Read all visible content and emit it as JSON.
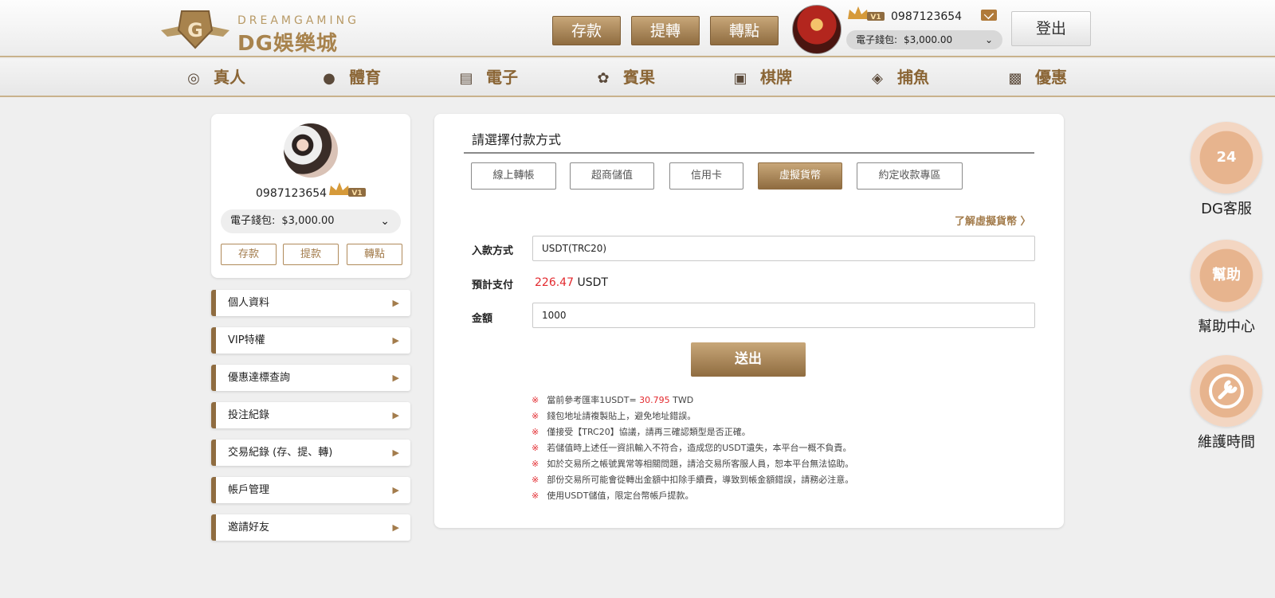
{
  "header": {
    "logo_sub": "DREAMGAMING",
    "logo_main": "DG娛樂城",
    "buttons": [
      "存款",
      "提轉",
      "轉點"
    ],
    "vip_badge": "V1",
    "username": "0987123654",
    "wallet_label": "電子錢包:",
    "wallet_amount": "$3,000.00",
    "logout": "登出"
  },
  "nav": {
    "items": [
      {
        "label": "真人",
        "icon": "live-icon"
      },
      {
        "label": "體育",
        "icon": "ball-icon"
      },
      {
        "label": "電子",
        "icon": "slot-icon"
      },
      {
        "label": "賓果",
        "icon": "bingo-icon"
      },
      {
        "label": "棋牌",
        "icon": "cards-icon"
      },
      {
        "label": "捕魚",
        "icon": "fish-icon"
      },
      {
        "label": "優惠",
        "icon": "gift-icon"
      }
    ]
  },
  "profile": {
    "username": "0987123654",
    "vip_badge": "V1",
    "wallet_label": "電子錢包:",
    "wallet_amount": "$3,000.00",
    "buttons": [
      "存款",
      "提款",
      "轉點"
    ]
  },
  "menu": {
    "items": [
      "個人資料",
      "VIP特權",
      "優惠達標查詢",
      "投注紀錄",
      "交易紀錄 (存、提、轉)",
      "帳戶管理",
      "邀請好友"
    ]
  },
  "payment": {
    "title": "請選擇付款方式",
    "tabs": [
      "線上轉帳",
      "超商儲值",
      "信用卡",
      "虛擬貨幣",
      "約定收款專區"
    ],
    "active_tab": "虛擬貨幣",
    "learn_more": "了解虛擬貨幣 〉",
    "method_label": "入款方式",
    "method_value": "USDT(TRC20)",
    "estimate_label": "預計支付",
    "estimate_value": "226.47",
    "estimate_unit": "USDT",
    "amount_label": "金額",
    "amount_value": "1000",
    "submit": "送出",
    "note_mark": "※",
    "note_rate_prefix": "當前參考匯率1USDT=",
    "note_rate_value": "30.795",
    "note_rate_unit": "TWD",
    "notes": [
      "錢包地址請複製貼上，避免地址錯誤。",
      "僅接受【TRC20】協議，請再三確認類型是否正確。",
      "若儲值時上述任一資訊輸入不符合，造成您的USDT遺失，本平台一概不負責。",
      "如於交易所之帳號異常等相關問題，請洽交易所客服人員，恕本平台無法協助。",
      "部份交易所可能會從轉出金額中扣除手續費，導致到帳金額錯誤，請務必注意。",
      "使用USDT儲值，限定台幣帳戶提款。"
    ]
  },
  "floating": {
    "items": [
      {
        "label": "DG客服",
        "icon_text": "24"
      },
      {
        "label": "幫助中心",
        "icon_text": "幫助"
      },
      {
        "label": "維護時間",
        "icon_text": ""
      }
    ]
  },
  "colors": {
    "gold": "#a37c4c",
    "gold_dark": "#8f6c40",
    "red": "#e3292e"
  }
}
